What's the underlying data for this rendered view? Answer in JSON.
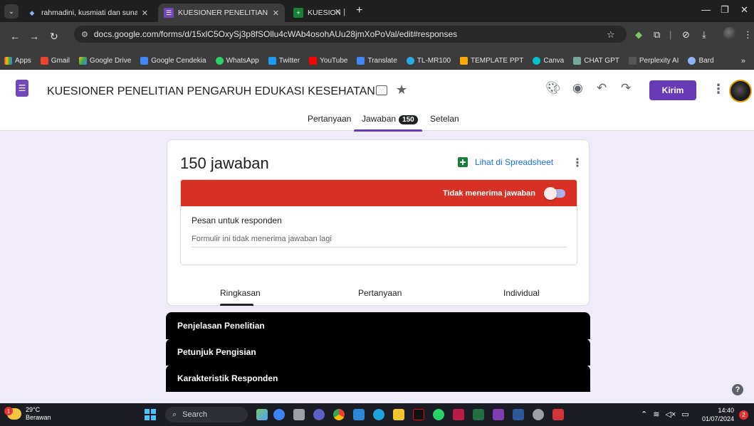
{
  "browser": {
    "tabs": [
      {
        "title": "rahmadini, kusmiati dan sunart",
        "active": false
      },
      {
        "title": "KUESIONER PENELITIAN PENG/",
        "active": true
      },
      {
        "title": "KUESIONER PENELITIAN PENG/",
        "active": false
      }
    ],
    "url": "docs.google.com/forms/d/15xlC5OxySj3p8fSOllu4cWAb4osohAUu28jmXoPoVal/edit#responses",
    "bookmarks": [
      "Apps",
      "Gmail",
      "Google Drive",
      "Google Cendekia",
      "WhatsApp",
      "Twitter",
      "YouTube",
      "Translate",
      "TL-MR100",
      "TEMPLATE PPT",
      "Canva",
      "CHAT GPT",
      "Perplexity AI",
      "Bard"
    ]
  },
  "form": {
    "title": "KUESIONER PENELITIAN PENGARUH EDUKASI KESEHATAN MENGENAI KA",
    "send_label": "Kirim",
    "tabs": {
      "questions": "Pertanyaan",
      "responses": "Jawaban",
      "responses_count": "150",
      "settings": "Setelan"
    }
  },
  "responses": {
    "count_label": "150 jawaban",
    "sheets_link": "Lihat di Spreadsheet",
    "accepting_label": "Tidak menerima jawaban",
    "accepting": false,
    "message_title": "Pesan untuk responden",
    "message_value": "Formulir ini tidak menerima jawaban lagi",
    "subtabs": [
      "Ringkasan",
      "Pertanyaan",
      "Individual"
    ]
  },
  "sections": [
    "Penjelasan Penelitian",
    "Petunjuk Pengisian",
    "Karakteristik Responden"
  ],
  "taskbar": {
    "temp": "29°C",
    "weather": "Berawan",
    "search": "Search",
    "time": "14:40",
    "date": "01/07/2024",
    "notif_count": "2",
    "weather_badge": "1"
  },
  "colors": {
    "accent": "#673ab7",
    "banner": "#d93025",
    "sheets": "#188038",
    "link": "#1a73e8"
  }
}
